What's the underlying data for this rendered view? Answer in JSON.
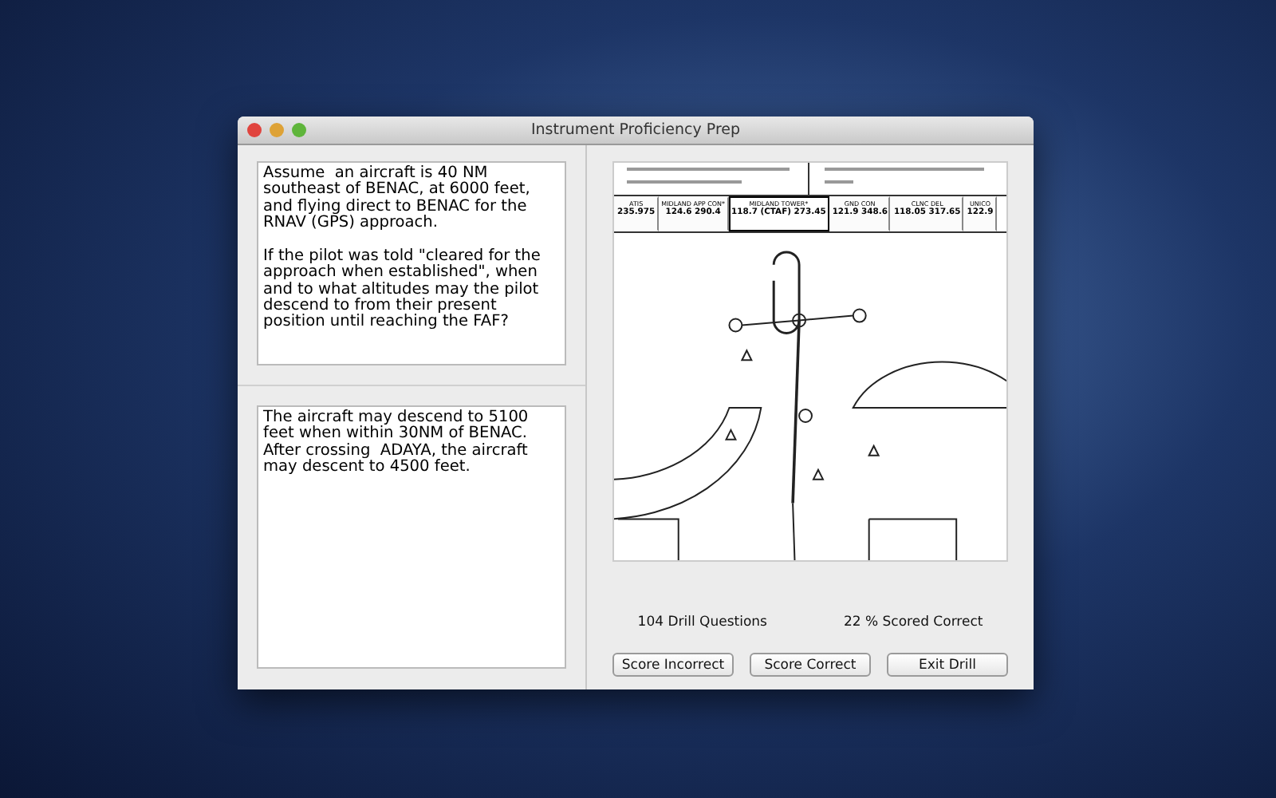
{
  "window": {
    "title": "Instrument Proficiency Prep"
  },
  "question": {
    "text": "Assume  an aircraft is 40 NM southeast of BENAC, at 6000 feet, and flying direct to BENAC for the RNAV (GPS) approach.\n\nIf the pilot was told \"cleared for the approach when established\", when and to what altitudes may the pilot descend to from their present position until reaching the FAF?"
  },
  "answer": {
    "text": "The aircraft may descend to 5100 feet when within 30NM of BENAC. After crossing  ADAYA, the aircraft may descent to 4500 feet."
  },
  "approach_chart": {
    "frequencies": [
      {
        "label": "ATIS",
        "value": "235.975",
        "boxed": false
      },
      {
        "label": "MIDLAND APP CON*",
        "value": "124.6  290.4",
        "boxed": false
      },
      {
        "label": "MIDLAND TOWER*",
        "value": "118.7 (CTAF) 273.45",
        "boxed": true
      },
      {
        "label": "GND CON",
        "value": "121.9  348.6",
        "boxed": false
      },
      {
        "label": "CLNC DEL",
        "value": "118.05  317.65",
        "boxed": false
      },
      {
        "label": "UNICO",
        "value": "122.9",
        "boxed": false
      }
    ]
  },
  "stats": {
    "questions": "104  Drill Questions",
    "score": "22 % Scored Correct"
  },
  "buttons": [
    "Score Incorrect",
    "Score Correct",
    "Exit Drill"
  ]
}
